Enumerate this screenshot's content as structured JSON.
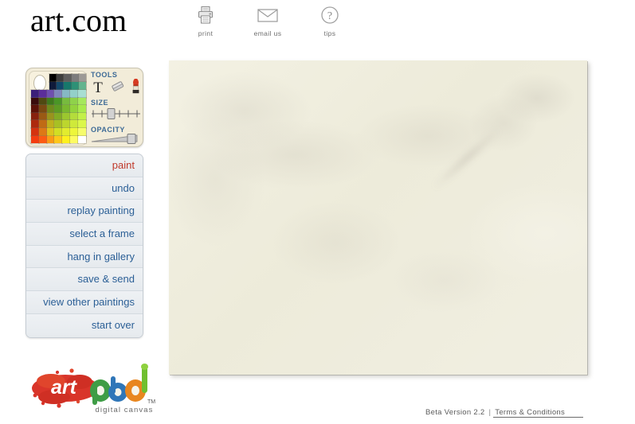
{
  "header": {
    "logo_text": "art.com",
    "nav": [
      {
        "label": "print",
        "icon": "printer-icon"
      },
      {
        "label": "email us",
        "icon": "envelope-icon"
      },
      {
        "label": "tips",
        "icon": "question-circle-icon"
      }
    ]
  },
  "tools_panel": {
    "tools_label": "TOOLS",
    "size_label": "SIZE",
    "opacity_label": "OPACITY",
    "current_color": "#ffffff",
    "tools": [
      {
        "name": "text-tool",
        "glyph": "T",
        "icon": "text-tool-icon"
      },
      {
        "name": "eraser-tool",
        "glyph": "",
        "icon": "eraser-icon"
      },
      {
        "name": "brush-tool",
        "glyph": "",
        "icon": "paint-brush-icon"
      }
    ],
    "size_value": 35,
    "size_ticks": 5,
    "opacity_value": 88,
    "palette_top_row": [
      "#000000",
      "#3e3e3e",
      "#5e5e5e",
      "#7d7d7d",
      "#9d9a96",
      "#0f1a3a",
      "#12486b",
      "#17786b",
      "#2e9176",
      "#63b48e"
    ],
    "palette_grid": [
      [
        "#3b1f7a",
        "#5b2d9a",
        "#6f4fb0",
        "#7f86bd",
        "#86b8c4",
        "#93d0c9",
        "#a8ded2"
      ],
      [
        "#3a0c0c",
        "#4f4a12",
        "#3f7a1d",
        "#4a9626",
        "#77bb3e",
        "#8fd24a",
        "#a6e85c"
      ],
      [
        "#5c1208",
        "#7a4a12",
        "#6f8a1c",
        "#5e9b23",
        "#79b82f",
        "#93d33c",
        "#a9ea4c"
      ],
      [
        "#87210d",
        "#9a5a14",
        "#99931d",
        "#82ab24",
        "#9bc72f",
        "#b4dd3b",
        "#c3f04a"
      ],
      [
        "#ad2a0d",
        "#c06b15",
        "#c0b01d",
        "#a8c024",
        "#bcd62e",
        "#cfe93a",
        "#dbf74a"
      ],
      [
        "#d4320f",
        "#dd7916",
        "#dfc41d",
        "#d2de24",
        "#e2ec2e",
        "#eef63a",
        "#f6fc6b"
      ],
      [
        "#f43c10",
        "#fc5b13",
        "#fb9a16",
        "#fdc71a",
        "#fdf01e",
        "#fdfb62",
        "#ffffff"
      ]
    ]
  },
  "menu": {
    "items": [
      {
        "label": "paint",
        "active": true
      },
      {
        "label": "undo",
        "active": false
      },
      {
        "label": "replay painting",
        "active": false
      },
      {
        "label": "select a frame",
        "active": false
      },
      {
        "label": "hang in gallery",
        "active": false
      },
      {
        "label": "save & send",
        "active": false
      },
      {
        "label": "view other paintings",
        "active": false
      },
      {
        "label": "start over",
        "active": false
      }
    ],
    "active_color": "#c0392b",
    "link_color": "#2b5f96"
  },
  "artpad_logo": {
    "word_art": "art",
    "word_pad": "pad",
    "tagline": "digital canvas",
    "trademark": "TM"
  },
  "canvas": {
    "background_color": "#efeddd",
    "description": "blank textured cream painting canvas"
  },
  "footer": {
    "version": "Beta Version 2.2",
    "separator": "|",
    "terms_label": "Terms & Conditions"
  }
}
